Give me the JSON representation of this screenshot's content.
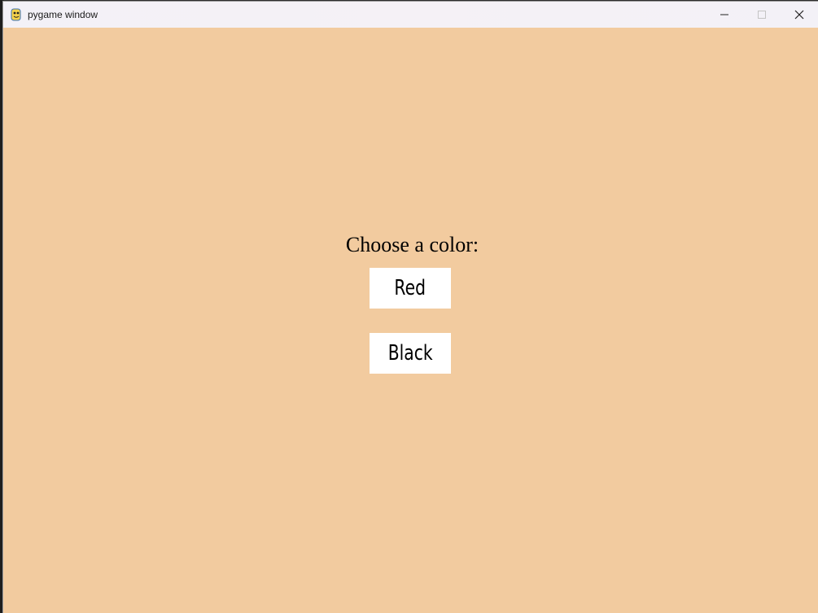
{
  "window": {
    "title": "pygame window",
    "background_color": "#f2cb9f"
  },
  "titlebar_icons": {
    "app": "pygame-snake-icon",
    "minimize": "minimize-icon",
    "maximize": "maximize-icon",
    "close": "close-icon"
  },
  "game": {
    "prompt": "Choose a color:",
    "choices": [
      {
        "label": "Red"
      },
      {
        "label": "Black"
      }
    ]
  }
}
